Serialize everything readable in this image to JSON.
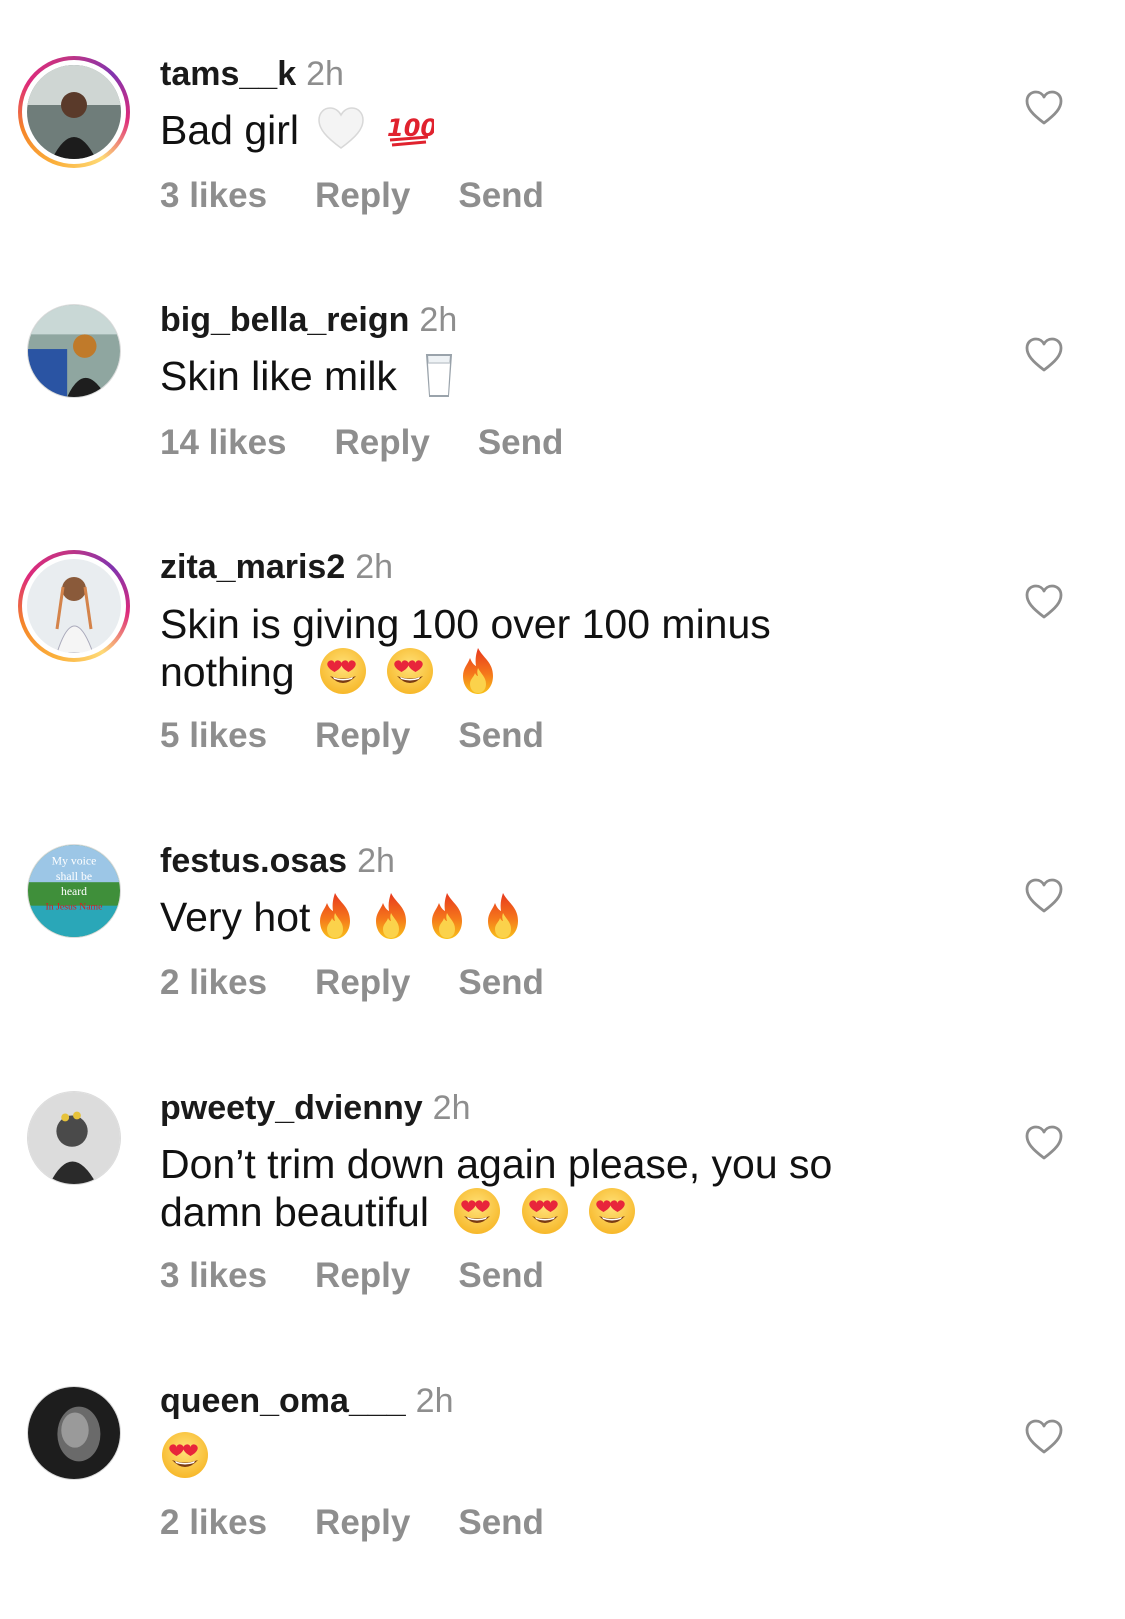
{
  "comments": [
    {
      "username": "tams__k",
      "time": "2h",
      "text": "Bad girl",
      "emojis": [
        "white-heart",
        "hundred-points"
      ],
      "likes": "3 likes",
      "reply": "Reply",
      "send": "Send",
      "story_ring": true
    },
    {
      "username": "big_bella_reign",
      "time": "2h",
      "text": "Skin like milk",
      "emojis": [
        "glass-of-milk"
      ],
      "likes": "14 likes",
      "reply": "Reply",
      "send": "Send",
      "story_ring": false
    },
    {
      "username": "zita_maris2",
      "time": "2h",
      "text_line1": "Skin is giving 100 over 100 minus",
      "text_line2": "nothing",
      "emojis": [
        "heart-eyes",
        "heart-eyes",
        "fire"
      ],
      "likes": "5 likes",
      "reply": "Reply",
      "send": "Send",
      "story_ring": true
    },
    {
      "username": "festus.osas",
      "time": "2h",
      "text": "Very hot",
      "emojis": [
        "fire",
        "fire",
        "fire",
        "fire"
      ],
      "likes": "2 likes",
      "reply": "Reply",
      "send": "Send",
      "story_ring": false,
      "avatar_text": [
        "My voice",
        "shall be",
        "heard",
        "In Jesus Name"
      ]
    },
    {
      "username": "pweety_dvienny",
      "time": "2h",
      "text_line1": "Don’t trim down again please, you so",
      "text_line2": "damn beautiful",
      "emojis": [
        "heart-eyes",
        "heart-eyes",
        "heart-eyes"
      ],
      "likes": "3 likes",
      "reply": "Reply",
      "send": "Send",
      "story_ring": false
    },
    {
      "username": "queen_oma___",
      "time": "2h",
      "text": "",
      "emojis": [
        "heart-eyes"
      ],
      "likes": "2 likes",
      "reply": "Reply",
      "send": "Send",
      "story_ring": false
    }
  ],
  "colors": {
    "secondary_text": "#8e8e8e",
    "primary_text": "#111111",
    "story_ring_start": "#fbb03b",
    "story_ring_end": "#c13584"
  }
}
